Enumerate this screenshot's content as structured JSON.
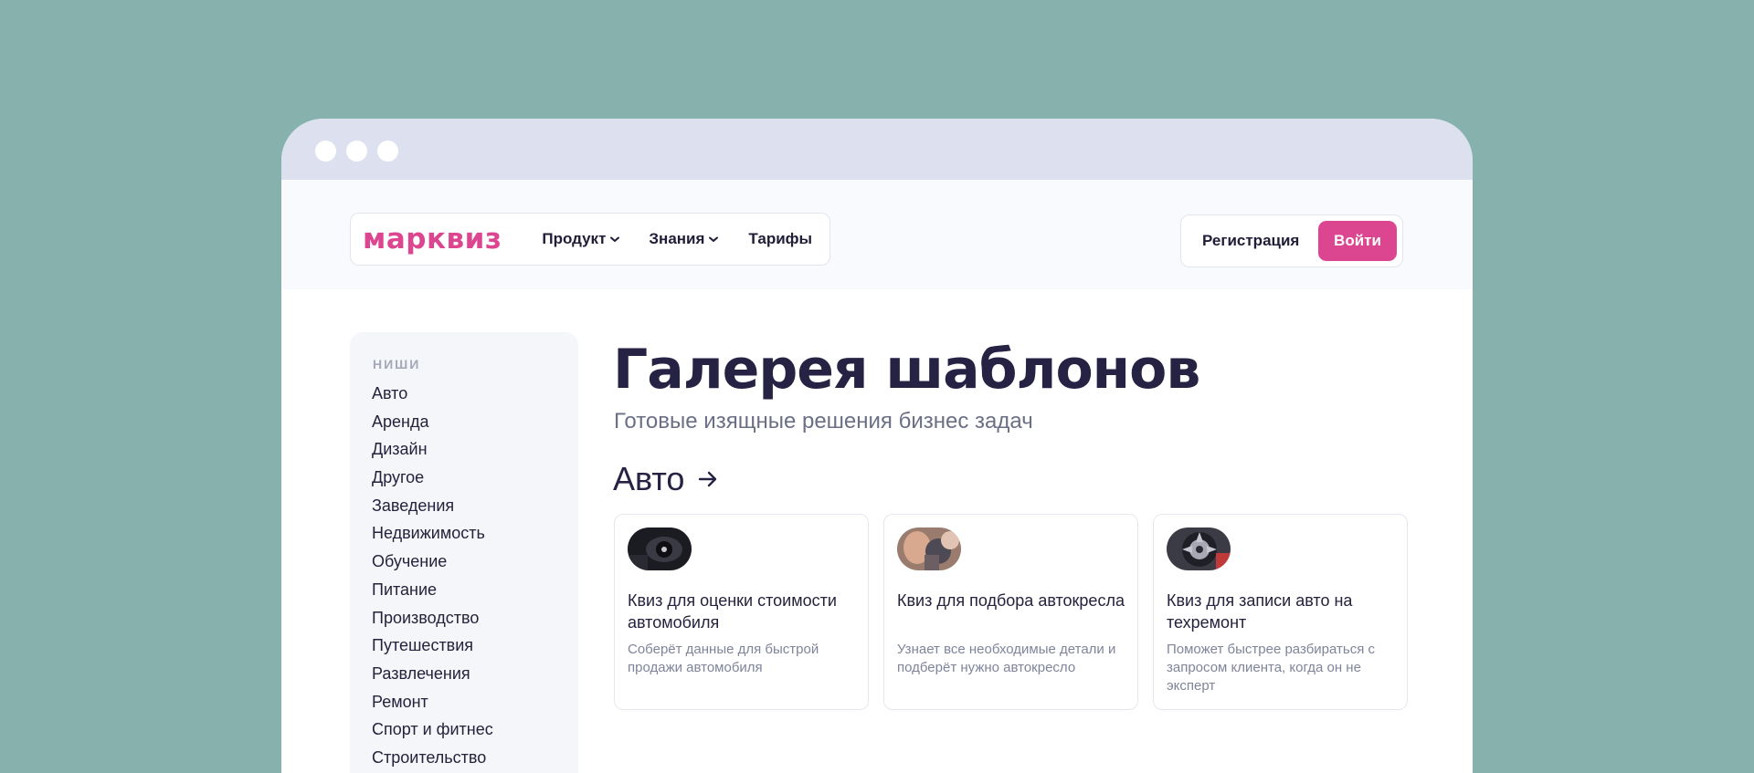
{
  "header": {
    "logo": "марквиз",
    "nav": [
      {
        "label": "Продукт",
        "icon": "chevron-down-icon"
      },
      {
        "label": "Знания",
        "icon": "chevron-down-icon"
      },
      {
        "label": "Тарифы"
      }
    ],
    "register_label": "Регистрация",
    "login_label": "Войти"
  },
  "sidebar": {
    "heading": "НИШИ",
    "items": [
      "Авто",
      "Аренда",
      "Дизайн",
      "Другое",
      "Заведения",
      "Недвижимость",
      "Обучение",
      "Питание",
      "Производство",
      "Путешествия",
      "Развлечения",
      "Ремонт",
      "Спорт и фитнес",
      "Строительство"
    ]
  },
  "main": {
    "title": "Галерея шаблонов",
    "subtitle": "Готовые изящные решения бизнес задач",
    "section_title": "Авто",
    "section_icon": "arrow-right-icon",
    "cards": [
      {
        "title": "Квиз для оценки стоимости автомобиля",
        "desc": "Соберёт данные для быстрой продажи автомобиля",
        "image": "car-interior-photo"
      },
      {
        "title": "Квиз для подбора автокресла",
        "desc": "Узнает все необходимые детали и подберёт нужно автокресло",
        "image": "car-seat-photo"
      },
      {
        "title": "Квиз для записи авто на техремонт",
        "desc": "Поможет быстрее разбираться с запросом клиента, когда он не эксперт",
        "image": "car-wheel-photo"
      }
    ]
  },
  "colors": {
    "background": "#86b1ad",
    "titlebar": "#dde1ef",
    "brand": "#dc4690",
    "heading": "#252244",
    "muted": "#6b6f86"
  }
}
